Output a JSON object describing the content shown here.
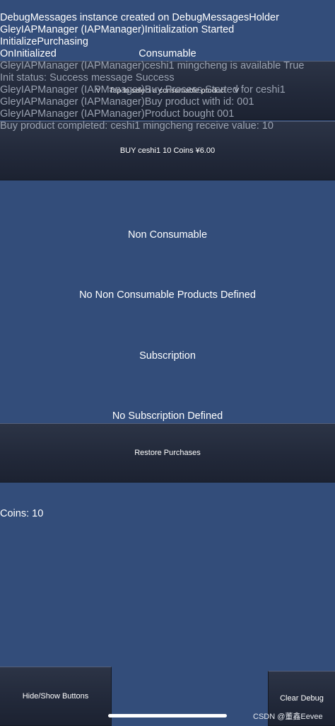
{
  "debug": {
    "lines": [
      "DebugMessages instance created on DebugMessagesHolder",
      "GleyIAPManager (IAPManager)Initialization Started",
      "InitializePurchasing",
      "OnInitialized"
    ],
    "grey_lines": [
      "GleyIAPManager (IAPManager)ceshi1 mingcheng is available True",
      "Init status: Success message Success",
      "GleyIAPManager (IAPManager)Buy Process Started for ceshi1",
      "GleyIAPManager (IAPManager)Buy product with id: 001",
      "GleyIAPManager (IAPManager)Product bought 001",
      "Buy product completed: ceshi1 mingcheng receive value: 10"
    ]
  },
  "consumable": {
    "heading": "Consumable",
    "dropdown_label": "Tap to select a consumable product",
    "chevron_left": "V",
    "chevron_right": "V",
    "buy_button": "BUY ceshi1 10 Coins ¥6.00"
  },
  "non_consumable": {
    "heading": "Non Consumable",
    "empty_text": "No Non Consumable Products Defined"
  },
  "subscription": {
    "heading": "Subscription",
    "empty_text": "No Subscription Defined"
  },
  "restore_button": "Restore Purchases",
  "coins_text": "Coins: 10",
  "bottom": {
    "hide_show_button": "Hide/Show Buttons",
    "clear_debug_button": "Clear Debug"
  },
  "watermark": "CSDN @董鑫Eevee"
}
